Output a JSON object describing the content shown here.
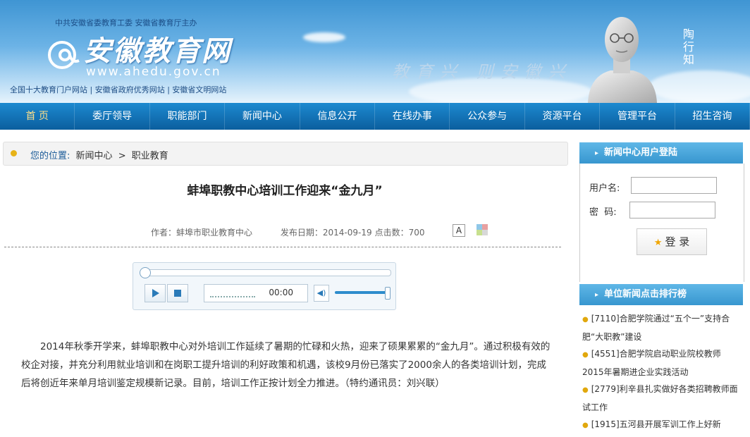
{
  "header": {
    "sponsor": "中共安徽省委教育工委 安徽省教育厅主办",
    "site_title": "安徽教育网",
    "site_url": "www.ahedu.gov.cn",
    "honors": "全国十大教育门户网站 | 安徽省政府优秀网站 | 安徽省文明网站",
    "motto": "教育兴 则安徽兴",
    "bust_name": "陶行知"
  },
  "nav": {
    "items": [
      "首 页",
      "委厅领导",
      "职能部门",
      "新闻中心",
      "信息公开",
      "在线办事",
      "公众参与",
      "资源平台",
      "管理平台",
      "招生咨询"
    ],
    "active_index": 0
  },
  "breadcrumb": {
    "label": "您的位置:",
    "items": [
      "新闻中心",
      "职业教育"
    ],
    "separator": ">"
  },
  "article": {
    "title": "蚌埠职教中心培训工作迎来“金九月”",
    "author_label": "作者：",
    "author": "蚌埠市职业教育中心",
    "date_label": "发布日期：",
    "date": "2014-09-19",
    "clicks_label": "点击数：",
    "clicks": "700",
    "font_button": "A",
    "body": "2014年秋季开学来，蚌埠职教中心对外培训工作延续了暑期的忙碌和火热，迎来了硕果累累的“金九月”。通过积极有效的校企对接，并充分利用就业培训和在岗职工提升培训的利好政策和机遇，该校9月份已落实了2000余人的各类培训计划，完成后将创近年来单月培训鉴定规模新记录。目前，培训工作正按计划全力推进。（特约通讯员：刘兴联）"
  },
  "player": {
    "time": "00:00",
    "progress": 0,
    "volume": 1.0
  },
  "sidebar": {
    "login_title": "新闻中心用户登陆",
    "username_label": "用户名:",
    "password_label": "密  码:",
    "login_button": "登 录",
    "ranking_title": "单位新闻点击排行榜",
    "news": [
      "[7110]合肥学院通过“五个一”支持合肥“大职教”建设",
      "[4551]合肥学院启动职业院校教师2015年暑期进企业实践活动",
      "[2779]利辛县扎实做好各类招聘教师面试工作",
      "[1915]五河县开展军训工作上好新"
    ]
  },
  "colors": {
    "nav_bg": "#0b5e9e",
    "accent_blue": "#3796cf",
    "bullet": "#e1a80d"
  }
}
